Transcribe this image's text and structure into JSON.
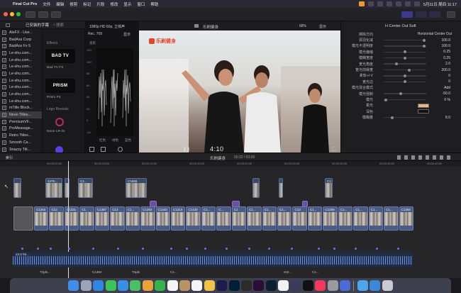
{
  "menubar": {
    "apple": "",
    "items": [
      "Final Cut Pro",
      "文件",
      "编辑",
      "修剪",
      "标记",
      "片段",
      "修改",
      "显示",
      "窗口",
      "帮助"
    ],
    "clock": "5月11日 周四 11:17"
  },
  "library": {
    "dropdown": "已安装的字幕",
    "search_placeholder": "搜索"
  },
  "effects_list": [
    "AleFX - Use...",
    "BadAss Corp",
    "BadAss Fx 5",
    "Le-shu.com...",
    "Le-shu.com...",
    "Le-shu.com...",
    "Le-shu.com...",
    "Le-shu.com...",
    "Le-shu.com...",
    "Le-shu.com...",
    "Le-shu.com...",
    "mTitle Block...",
    "Neon Titles...",
    "PremiumVF...",
    "ProMessage...",
    "Retro Titles...",
    "Smooth Ca...",
    "Snazzy Titl..."
  ],
  "browser": {
    "section1": "Effects",
    "thumb1": "BAD TV",
    "thumb1_label": "Bad TV FX",
    "thumb2": "PRISM",
    "thumb2_label": "Prism FX",
    "section2": "Logo Reveals",
    "thumb3_label": "Neon LR 01"
  },
  "scopes": {
    "format": "Rec. 709",
    "show": "显示",
    "title": "波形",
    "y_ticks": [
      "120",
      "100",
      "80",
      "60",
      "40",
      "20",
      "0",
      "-20"
    ],
    "channels": [
      "红色",
      "绿色",
      "蓝色"
    ]
  },
  "viewer": {
    "format": "1080p HD 60p, 立体声",
    "project": "乐刷健身",
    "zoom": "68%",
    "show": "显示",
    "timecode": "4:10",
    "watermark": "乐刷健身"
  },
  "inspector": {
    "title": "H Center Out Soft",
    "rows": [
      {
        "label": "擦除方向",
        "value": "Horizontal Center Out",
        "knob": null
      },
      {
        "label": "源羽化减",
        "value": "100.0",
        "knob": 0.95
      },
      {
        "label": "模光不透明度",
        "value": "100.0",
        "knob": 0.95
      },
      {
        "label": "模光偏缩",
        "value": "0.25",
        "knob": 0.5
      },
      {
        "label": "模糊宽度",
        "value": "0.25",
        "knob": 0.5
      },
      {
        "label": "宽光角度",
        "value": "2.0",
        "knob": 0.3
      },
      {
        "label": "宽光前缘宽",
        "value": "200.0",
        "knob": 0.6
      },
      {
        "label": "柔软+/-V",
        "value": "0",
        "knob": 0.5
      },
      {
        "label": "宽光边",
        "value": "0",
        "knob": 0.5
      },
      {
        "label": "模光混合模式",
        "value": "Add",
        "knob": null
      },
      {
        "label": "模光强制",
        "value": "-50.0",
        "knob": 0.4
      },
      {
        "label": "模光",
        "value": "0 %",
        "knob": 0.05
      },
      {
        "label": "柔光",
        "value": "",
        "knob": null,
        "swatch": "#f2b380"
      },
      {
        "label": "深色",
        "value": "",
        "knob": null,
        "swatch": "#111111"
      },
      {
        "label": "模糊量",
        "value": "8.0",
        "knob": 0.2
      }
    ]
  },
  "timeline": {
    "index": "索引",
    "project": "乐刷健身",
    "position": "00:22 / 03:09",
    "ruler": [
      "00:00:00:00",
      "00:00:05:00",
      "00:00:10:00",
      "00:00:15:00",
      "00:00:20:00",
      "00:00:25:00",
      "00:00:30:00",
      "00:00:35:00",
      "00:00:40:00"
    ],
    "connected_clips": [
      {
        "name": "",
        "x": 19,
        "w": 11
      },
      {
        "name": "4279...",
        "x": 64,
        "w": 24
      },
      {
        "name": "",
        "x": 91,
        "w": 7
      },
      {
        "name": "C1...",
        "x": 110,
        "w": 21
      },
      {
        "name": "C1688",
        "x": 177,
        "w": 30
      },
      {
        "name": "",
        "x": 356,
        "w": 10
      },
      {
        "name": "",
        "x": 393,
        "w": 6
      },
      {
        "name": "C1...",
        "x": 458,
        "w": 11
      }
    ],
    "main_clips": [
      "C1263",
      "C12",
      "C1331",
      "C1",
      "C1387",
      "C13",
      "C1...",
      "C1382",
      "C1343",
      "C1310",
      "C1420",
      "C1...",
      "C...",
      "C1",
      "C1...",
      "C1...",
      "C1...",
      "C13",
      "C1...",
      "C1359",
      "C1...",
      "C1...",
      "C1...",
      "C1...",
      "C1358"
    ],
    "titles": [
      {
        "name": "",
        "x": 211,
        "w": 10
      },
      {
        "name": "",
        "x": 327,
        "w": 11
      },
      {
        "name": "",
        "x": 426,
        "w": 8
      }
    ],
    "audio_label": "23.8 h8...",
    "audio_subclips": [
      "Triple...",
      "C1284",
      "Triple",
      "C1...",
      "v02...",
      "C1..."
    ]
  },
  "dock": [
    "Finder",
    "Launchpad",
    "Safari",
    "Messages",
    "Mail",
    "Maps",
    "Photos",
    "FaceTime",
    "Calendar",
    "Contacts",
    "Reminders",
    "Notes",
    "After Effects",
    "Photoshop",
    "Final Cut",
    "Premiere",
    "Lightroom",
    "Chrome",
    "Motion",
    "TV",
    "Music",
    "Settings",
    "Compressor",
    "Folder",
    "Downloads",
    "Trash"
  ]
}
